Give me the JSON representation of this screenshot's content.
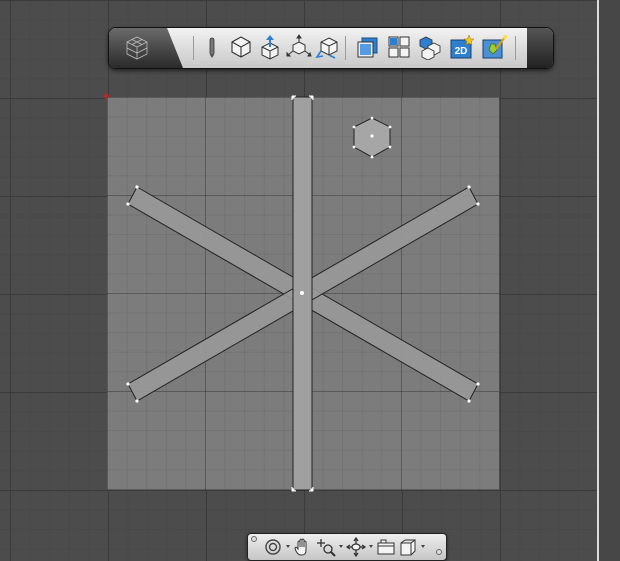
{
  "toolbar": {
    "tools": [
      {
        "name": "pen-tool"
      },
      {
        "name": "cube-view"
      },
      {
        "name": "move-up-view"
      },
      {
        "name": "axis-move"
      },
      {
        "name": "rotate-view"
      },
      {
        "name": "front-view"
      },
      {
        "name": "grid-layout"
      },
      {
        "name": "group-blocks"
      },
      {
        "name": "2d-view",
        "label": "2D"
      },
      {
        "name": "render-magic"
      }
    ]
  },
  "bottom_toolbar": {
    "tools": [
      "orbit",
      "pan",
      "zoom",
      "walk",
      "look-around",
      "box-view"
    ]
  },
  "colors": {
    "background": "#4c4c4c",
    "sheet": "#7c7c7c",
    "bar_fill": "#999999",
    "accent_blue": "#2f7fd0",
    "origin_marker": "#d02020"
  }
}
